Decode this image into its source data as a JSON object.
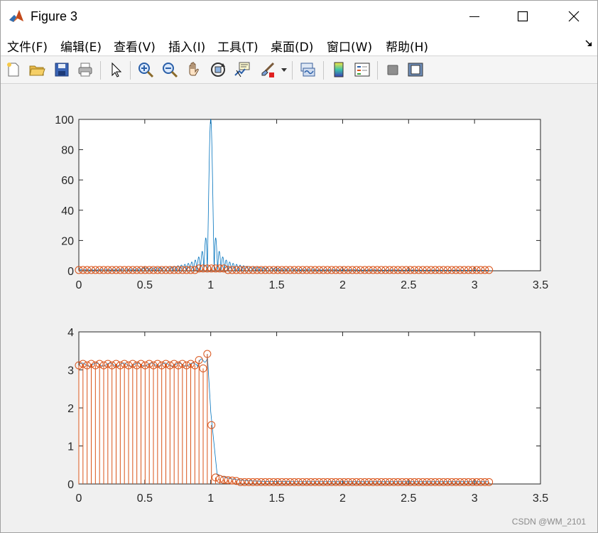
{
  "window": {
    "title": "Figure 3"
  },
  "menu": {
    "items": [
      "文件(F)",
      "编辑(E)",
      "查看(V)",
      "插入(I)",
      "工具(T)",
      "桌面(D)",
      "窗口(W)",
      "帮助(H)"
    ]
  },
  "toolbar": {
    "icons": [
      "new-figure-icon",
      "open-file-icon",
      "save-icon",
      "print-icon",
      "edit-pointer-icon",
      "zoom-in-icon",
      "zoom-out-icon",
      "pan-hand-icon",
      "rotate-3d-icon",
      "data-cursor-icon",
      "brush-icon",
      "brush-dropdown-icon",
      "link-plot-icon",
      "colorbar-icon",
      "legend-icon",
      "hide-plot-tools-icon",
      "show-plot-tools-icon"
    ]
  },
  "colors": {
    "line": "#0072BD",
    "stem": "#D95319",
    "axes_bg": "#ffffff",
    "figure_bg": "#f0f0f0"
  },
  "chart_data": [
    {
      "type": "line",
      "description_series": [
        {
          "name": "",
          "kind": "line",
          "color": "#0072BD"
        },
        {
          "name": "",
          "kind": "stem",
          "color": "#D95319"
        }
      ],
      "xlim": [
        0,
        3.5
      ],
      "ylim": [
        0,
        100
      ],
      "xticks": [
        "0",
        "0.5",
        "1",
        "1.5",
        "2",
        "2.5",
        "3",
        "3.5"
      ],
      "yticks": [
        "0",
        "20",
        "40",
        "60",
        "80",
        "100"
      ],
      "peak": {
        "x": 1.0,
        "y": 100
      },
      "stem_x_step": 0.031416,
      "stem_count": 100,
      "stem_values": {
        "default": 0.5,
        "near_peak": 1.5,
        "peak": 100
      },
      "line_sidelobes": [
        {
          "x": 0.95,
          "y": 20
        },
        {
          "x": 1.05,
          "y": 22
        },
        {
          "x": 0.925,
          "y": 12
        },
        {
          "x": 1.075,
          "y": 13
        },
        {
          "x": 0.9,
          "y": 8
        },
        {
          "x": 1.1,
          "y": 8
        }
      ]
    },
    {
      "type": "line",
      "xlim": [
        0,
        3.5
      ],
      "ylim": [
        0,
        4
      ],
      "xticks": [
        "0",
        "0.5",
        "1",
        "1.5",
        "2",
        "2.5",
        "3",
        "3.5"
      ],
      "yticks": [
        "0",
        "1",
        "2",
        "3",
        "4"
      ],
      "stem_x_step": 0.031416,
      "stem_count": 100,
      "plateau_value": 3.14,
      "stem_peak": {
        "x": 0.974,
        "y": 3.42
      },
      "stem_drop": {
        "x": 1.005,
        "y": 1.55
      },
      "tail_values": [
        0.3,
        0.17,
        0.13,
        0.11,
        0.1,
        0.09,
        0.08
      ]
    }
  ],
  "watermark": "CSDN @WM_2101"
}
